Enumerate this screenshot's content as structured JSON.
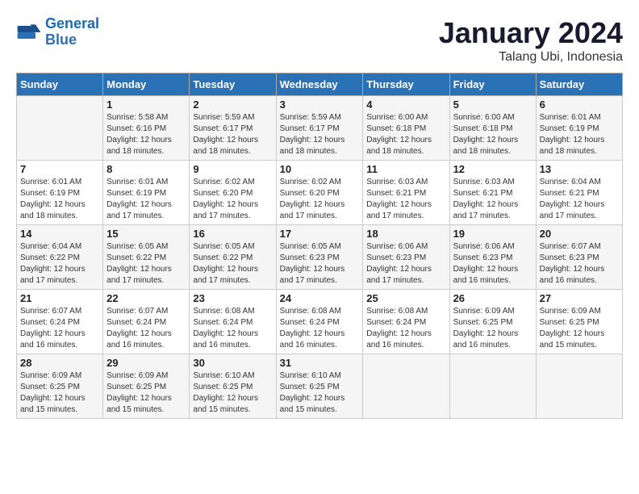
{
  "logo": {
    "line1": "General",
    "line2": "Blue"
  },
  "title": "January 2024",
  "subtitle": "Talang Ubi, Indonesia",
  "weekdays": [
    "Sunday",
    "Monday",
    "Tuesday",
    "Wednesday",
    "Thursday",
    "Friday",
    "Saturday"
  ],
  "weeks": [
    [
      {
        "day": "",
        "info": ""
      },
      {
        "day": "1",
        "info": "Sunrise: 5:58 AM\nSunset: 6:16 PM\nDaylight: 12 hours\nand 18 minutes."
      },
      {
        "day": "2",
        "info": "Sunrise: 5:59 AM\nSunset: 6:17 PM\nDaylight: 12 hours\nand 18 minutes."
      },
      {
        "day": "3",
        "info": "Sunrise: 5:59 AM\nSunset: 6:17 PM\nDaylight: 12 hours\nand 18 minutes."
      },
      {
        "day": "4",
        "info": "Sunrise: 6:00 AM\nSunset: 6:18 PM\nDaylight: 12 hours\nand 18 minutes."
      },
      {
        "day": "5",
        "info": "Sunrise: 6:00 AM\nSunset: 6:18 PM\nDaylight: 12 hours\nand 18 minutes."
      },
      {
        "day": "6",
        "info": "Sunrise: 6:01 AM\nSunset: 6:19 PM\nDaylight: 12 hours\nand 18 minutes."
      }
    ],
    [
      {
        "day": "7",
        "info": "Sunrise: 6:01 AM\nSunset: 6:19 PM\nDaylight: 12 hours\nand 18 minutes."
      },
      {
        "day": "8",
        "info": "Sunrise: 6:01 AM\nSunset: 6:19 PM\nDaylight: 12 hours\nand 17 minutes."
      },
      {
        "day": "9",
        "info": "Sunrise: 6:02 AM\nSunset: 6:20 PM\nDaylight: 12 hours\nand 17 minutes."
      },
      {
        "day": "10",
        "info": "Sunrise: 6:02 AM\nSunset: 6:20 PM\nDaylight: 12 hours\nand 17 minutes."
      },
      {
        "day": "11",
        "info": "Sunrise: 6:03 AM\nSunset: 6:21 PM\nDaylight: 12 hours\nand 17 minutes."
      },
      {
        "day": "12",
        "info": "Sunrise: 6:03 AM\nSunset: 6:21 PM\nDaylight: 12 hours\nand 17 minutes."
      },
      {
        "day": "13",
        "info": "Sunrise: 6:04 AM\nSunset: 6:21 PM\nDaylight: 12 hours\nand 17 minutes."
      }
    ],
    [
      {
        "day": "14",
        "info": "Sunrise: 6:04 AM\nSunset: 6:22 PM\nDaylight: 12 hours\nand 17 minutes."
      },
      {
        "day": "15",
        "info": "Sunrise: 6:05 AM\nSunset: 6:22 PM\nDaylight: 12 hours\nand 17 minutes."
      },
      {
        "day": "16",
        "info": "Sunrise: 6:05 AM\nSunset: 6:22 PM\nDaylight: 12 hours\nand 17 minutes."
      },
      {
        "day": "17",
        "info": "Sunrise: 6:05 AM\nSunset: 6:23 PM\nDaylight: 12 hours\nand 17 minutes."
      },
      {
        "day": "18",
        "info": "Sunrise: 6:06 AM\nSunset: 6:23 PM\nDaylight: 12 hours\nand 17 minutes."
      },
      {
        "day": "19",
        "info": "Sunrise: 6:06 AM\nSunset: 6:23 PM\nDaylight: 12 hours\nand 16 minutes."
      },
      {
        "day": "20",
        "info": "Sunrise: 6:07 AM\nSunset: 6:23 PM\nDaylight: 12 hours\nand 16 minutes."
      }
    ],
    [
      {
        "day": "21",
        "info": "Sunrise: 6:07 AM\nSunset: 6:24 PM\nDaylight: 12 hours\nand 16 minutes."
      },
      {
        "day": "22",
        "info": "Sunrise: 6:07 AM\nSunset: 6:24 PM\nDaylight: 12 hours\nand 16 minutes."
      },
      {
        "day": "23",
        "info": "Sunrise: 6:08 AM\nSunset: 6:24 PM\nDaylight: 12 hours\nand 16 minutes."
      },
      {
        "day": "24",
        "info": "Sunrise: 6:08 AM\nSunset: 6:24 PM\nDaylight: 12 hours\nand 16 minutes."
      },
      {
        "day": "25",
        "info": "Sunrise: 6:08 AM\nSunset: 6:24 PM\nDaylight: 12 hours\nand 16 minutes."
      },
      {
        "day": "26",
        "info": "Sunrise: 6:09 AM\nSunset: 6:25 PM\nDaylight: 12 hours\nand 16 minutes."
      },
      {
        "day": "27",
        "info": "Sunrise: 6:09 AM\nSunset: 6:25 PM\nDaylight: 12 hours\nand 15 minutes."
      }
    ],
    [
      {
        "day": "28",
        "info": "Sunrise: 6:09 AM\nSunset: 6:25 PM\nDaylight: 12 hours\nand 15 minutes."
      },
      {
        "day": "29",
        "info": "Sunrise: 6:09 AM\nSunset: 6:25 PM\nDaylight: 12 hours\nand 15 minutes."
      },
      {
        "day": "30",
        "info": "Sunrise: 6:10 AM\nSunset: 6:25 PM\nDaylight: 12 hours\nand 15 minutes."
      },
      {
        "day": "31",
        "info": "Sunrise: 6:10 AM\nSunset: 6:25 PM\nDaylight: 12 hours\nand 15 minutes."
      },
      {
        "day": "",
        "info": ""
      },
      {
        "day": "",
        "info": ""
      },
      {
        "day": "",
        "info": ""
      }
    ]
  ]
}
